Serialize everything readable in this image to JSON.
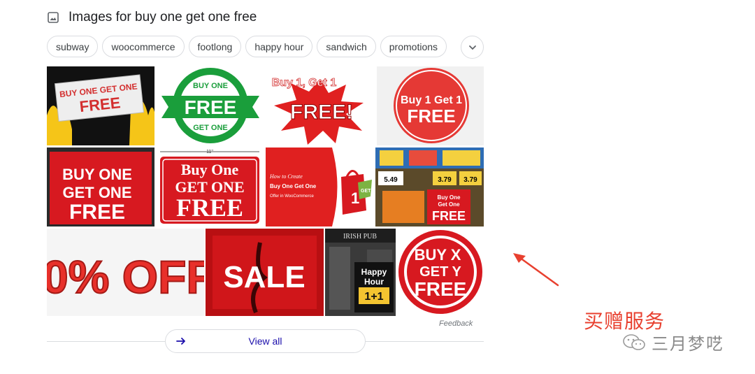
{
  "header": {
    "title": "Images for buy one get one free",
    "icon": "image-icon"
  },
  "chips": [
    "subway",
    "woocommerce",
    "footlong",
    "happy hour",
    "sandwich",
    "promotions"
  ],
  "chip_more_icon": "chevron-down-icon",
  "images": [
    {
      "text": [
        "BUY ONE GET ONE",
        "FREE"
      ]
    },
    {
      "text": [
        "BUY ONE",
        "FREE",
        "GET ONE"
      ]
    },
    {
      "text": [
        "Buy 1, Get 1",
        "FREE!"
      ]
    },
    {
      "text": [
        "Buy 1 Get 1",
        "FREE"
      ]
    },
    {
      "text": [
        "BUY ONE",
        "GET ONE",
        "FREE"
      ]
    },
    {
      "text": [
        "11\"",
        "Buy One",
        "GET ONE",
        "FREE"
      ]
    },
    {
      "text": [
        "How to Create",
        "Buy One Get One",
        "Offer in WooCommerce",
        "1",
        "GET"
      ]
    },
    {
      "text": [
        "5.49",
        "3.79",
        "3.79",
        "Buy One",
        "Get One",
        "FREE"
      ]
    },
    {
      "text": [
        "0% OFF"
      ]
    },
    {
      "text": [
        "SALE"
      ]
    },
    {
      "text": [
        "IRISH PUB",
        "Happy",
        "Hour",
        "1+1"
      ]
    },
    {
      "text": [
        "BUY X",
        "GET Y",
        "FREE"
      ]
    }
  ],
  "feedback": "Feedback",
  "view_all": "View all",
  "annotation": {
    "text": "买赠服务",
    "color": "#e8402f"
  },
  "watermark": {
    "text": "三月梦呓",
    "icon": "wechat-icon"
  }
}
